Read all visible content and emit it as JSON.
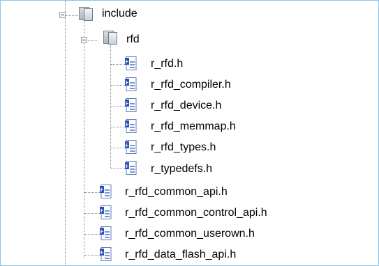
{
  "tree": {
    "folders": [
      {
        "label": "include",
        "expanded": true,
        "icon": "folder-icon"
      },
      {
        "label": "rfd",
        "expanded": true,
        "icon": "folder-icon"
      }
    ],
    "rfd_files": [
      {
        "label": "r_rfd.h",
        "icon": "header-file-icon"
      },
      {
        "label": "r_rfd_compiler.h",
        "icon": "header-file-icon"
      },
      {
        "label": "r_rfd_device.h",
        "icon": "header-file-icon"
      },
      {
        "label": "r_rfd_memmap.h",
        "icon": "header-file-icon"
      },
      {
        "label": "r_rfd_types.h",
        "icon": "header-file-icon"
      },
      {
        "label": "r_typedefs.h",
        "icon": "header-file-icon"
      }
    ],
    "include_files": [
      {
        "label": "r_rfd_common_api.h",
        "icon": "header-file-icon"
      },
      {
        "label": "r_rfd_common_control_api.h",
        "icon": "header-file-icon"
      },
      {
        "label": "r_rfd_common_userown.h",
        "icon": "header-file-icon"
      },
      {
        "label": "r_rfd_data_flash_api.h",
        "icon": "header-file-icon"
      }
    ],
    "colors": {
      "border": "#8fc3ea",
      "tree_line": "#8c8c8c",
      "file_icon_blue": "#3050b8",
      "file_icon_page": "#ffffff",
      "folder_icon": "#aeb5c2"
    }
  }
}
